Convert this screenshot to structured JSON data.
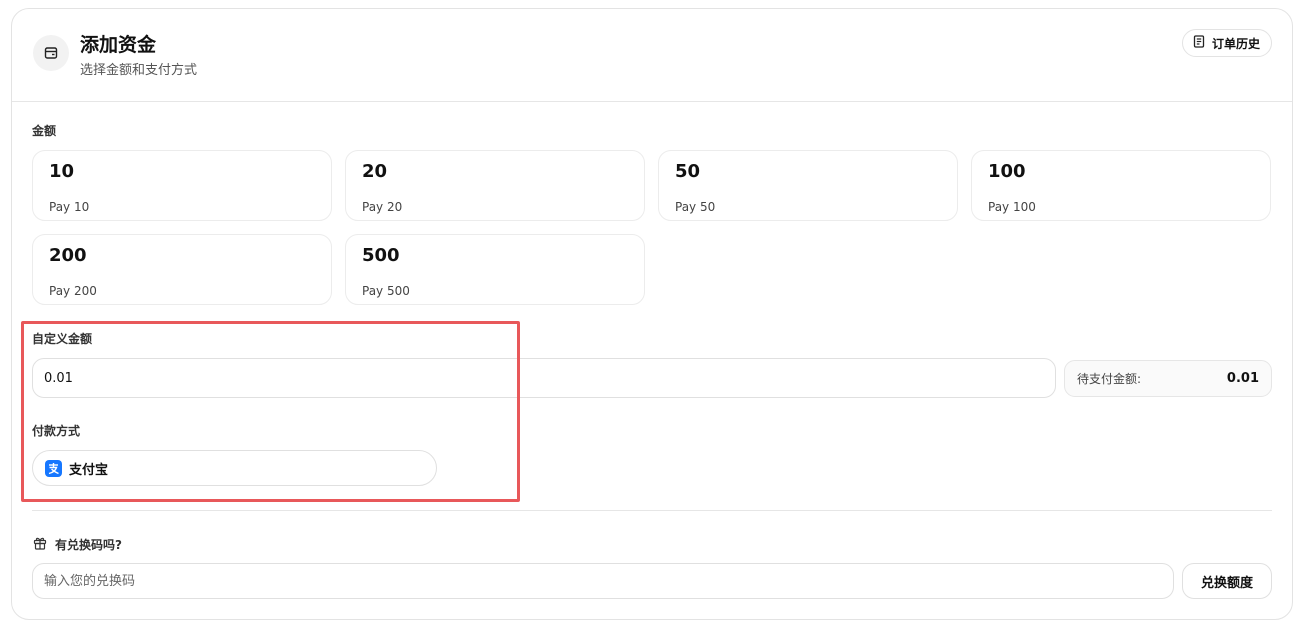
{
  "header": {
    "icon": "wallet-icon",
    "title": "添加资金",
    "subtitle": "选择金额和支付方式",
    "history_icon": "receipt-icon",
    "history_label": "订单历史"
  },
  "amount_section": {
    "label": "金额",
    "options": [
      {
        "value": "10",
        "sub": "Pay 10"
      },
      {
        "value": "20",
        "sub": "Pay 20"
      },
      {
        "value": "50",
        "sub": "Pay 50"
      },
      {
        "value": "100",
        "sub": "Pay 100"
      },
      {
        "value": "200",
        "sub": "Pay 200"
      },
      {
        "value": "500",
        "sub": "Pay 500"
      }
    ]
  },
  "custom_amount": {
    "label": "自定义金额",
    "value": "0.01",
    "pending_label": "待支付金额:",
    "pending_value": "0.01"
  },
  "payment": {
    "label": "付款方式",
    "method_icon": "alipay-icon",
    "method_label": "支付宝"
  },
  "redeem": {
    "icon": "gift-icon",
    "label": "有兑换码吗?",
    "placeholder": "输入您的兑换码",
    "button_label": "兑换额度"
  },
  "colors": {
    "highlight": "#e8585a",
    "alipay": "#1677ff"
  }
}
